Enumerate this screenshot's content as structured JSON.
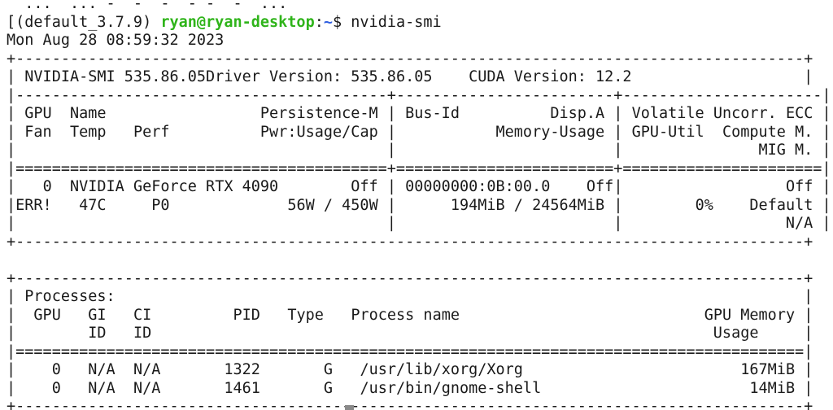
{
  "terminal": {
    "top_partial_line": "  ...  ... -  -  -  - -  -  ...",
    "prompt": {
      "env": "(default_3.7.9)",
      "user_host": "ryan@ryan-desktop",
      "separator": ":",
      "cwd": "~",
      "symbol": "$",
      "command": "nvidia-smi"
    },
    "timestamp": "Mon Aug 28 08:59:32 2023"
  },
  "smi": {
    "header": {
      "smi_version": "NVIDIA-SMI 535.86.05",
      "driver_version": "Driver Version: 535.86.05",
      "cuda_version": "CUDA Version: 12.2"
    },
    "columns": {
      "c1_line1_gpu": "GPU",
      "c1_line1_name": "Name",
      "c1_line1_persistence": "Persistence-M",
      "c1_line2_fan": "Fan",
      "c1_line2_temp": "Temp",
      "c1_line2_perf": "Perf",
      "c1_line2_pwr": "Pwr:Usage/Cap",
      "c2_line1_busid": "Bus-Id",
      "c2_line1_dispa": "Disp.A",
      "c2_line2_memusage": "Memory-Usage",
      "c3_line1": "Volatile Uncorr. ECC",
      "c3_line2_util": "GPU-Util",
      "c3_line2_compute": "Compute M.",
      "c3_line3_mig": "MIG M."
    },
    "gpu": {
      "index": "0",
      "name": "NVIDIA GeForce RTX 4090",
      "persistence": "Off",
      "fan": "ERR!",
      "temp": "47C",
      "perf": "P0",
      "power": "56W / 450W",
      "bus_id": "00000000:0B:00.0",
      "disp_a": "Off",
      "memory_usage": "194MiB / 24564MiB",
      "ecc": "Off",
      "gpu_util": "0%",
      "compute_mode": "Default",
      "mig_mode": "N/A"
    },
    "processes": {
      "title": "Processes:",
      "header": {
        "gpu": "GPU",
        "gi": "GI",
        "ci": "CI",
        "pid": "PID",
        "type": "Type",
        "name": "Process name",
        "gpu_memory": "GPU Memory",
        "gi_id": "ID",
        "ci_id": "ID",
        "usage": "Usage"
      },
      "rows": [
        {
          "gpu": "0",
          "gi": "N/A",
          "ci": "N/A",
          "pid": "1322",
          "type": "G",
          "name": "/usr/lib/xorg/Xorg",
          "memory": "167MiB"
        },
        {
          "gpu": "0",
          "gi": "N/A",
          "ci": "N/A",
          "pid": "1461",
          "type": "G",
          "name": "/usr/bin/gnome-shell",
          "memory": "14MiB"
        }
      ]
    }
  }
}
